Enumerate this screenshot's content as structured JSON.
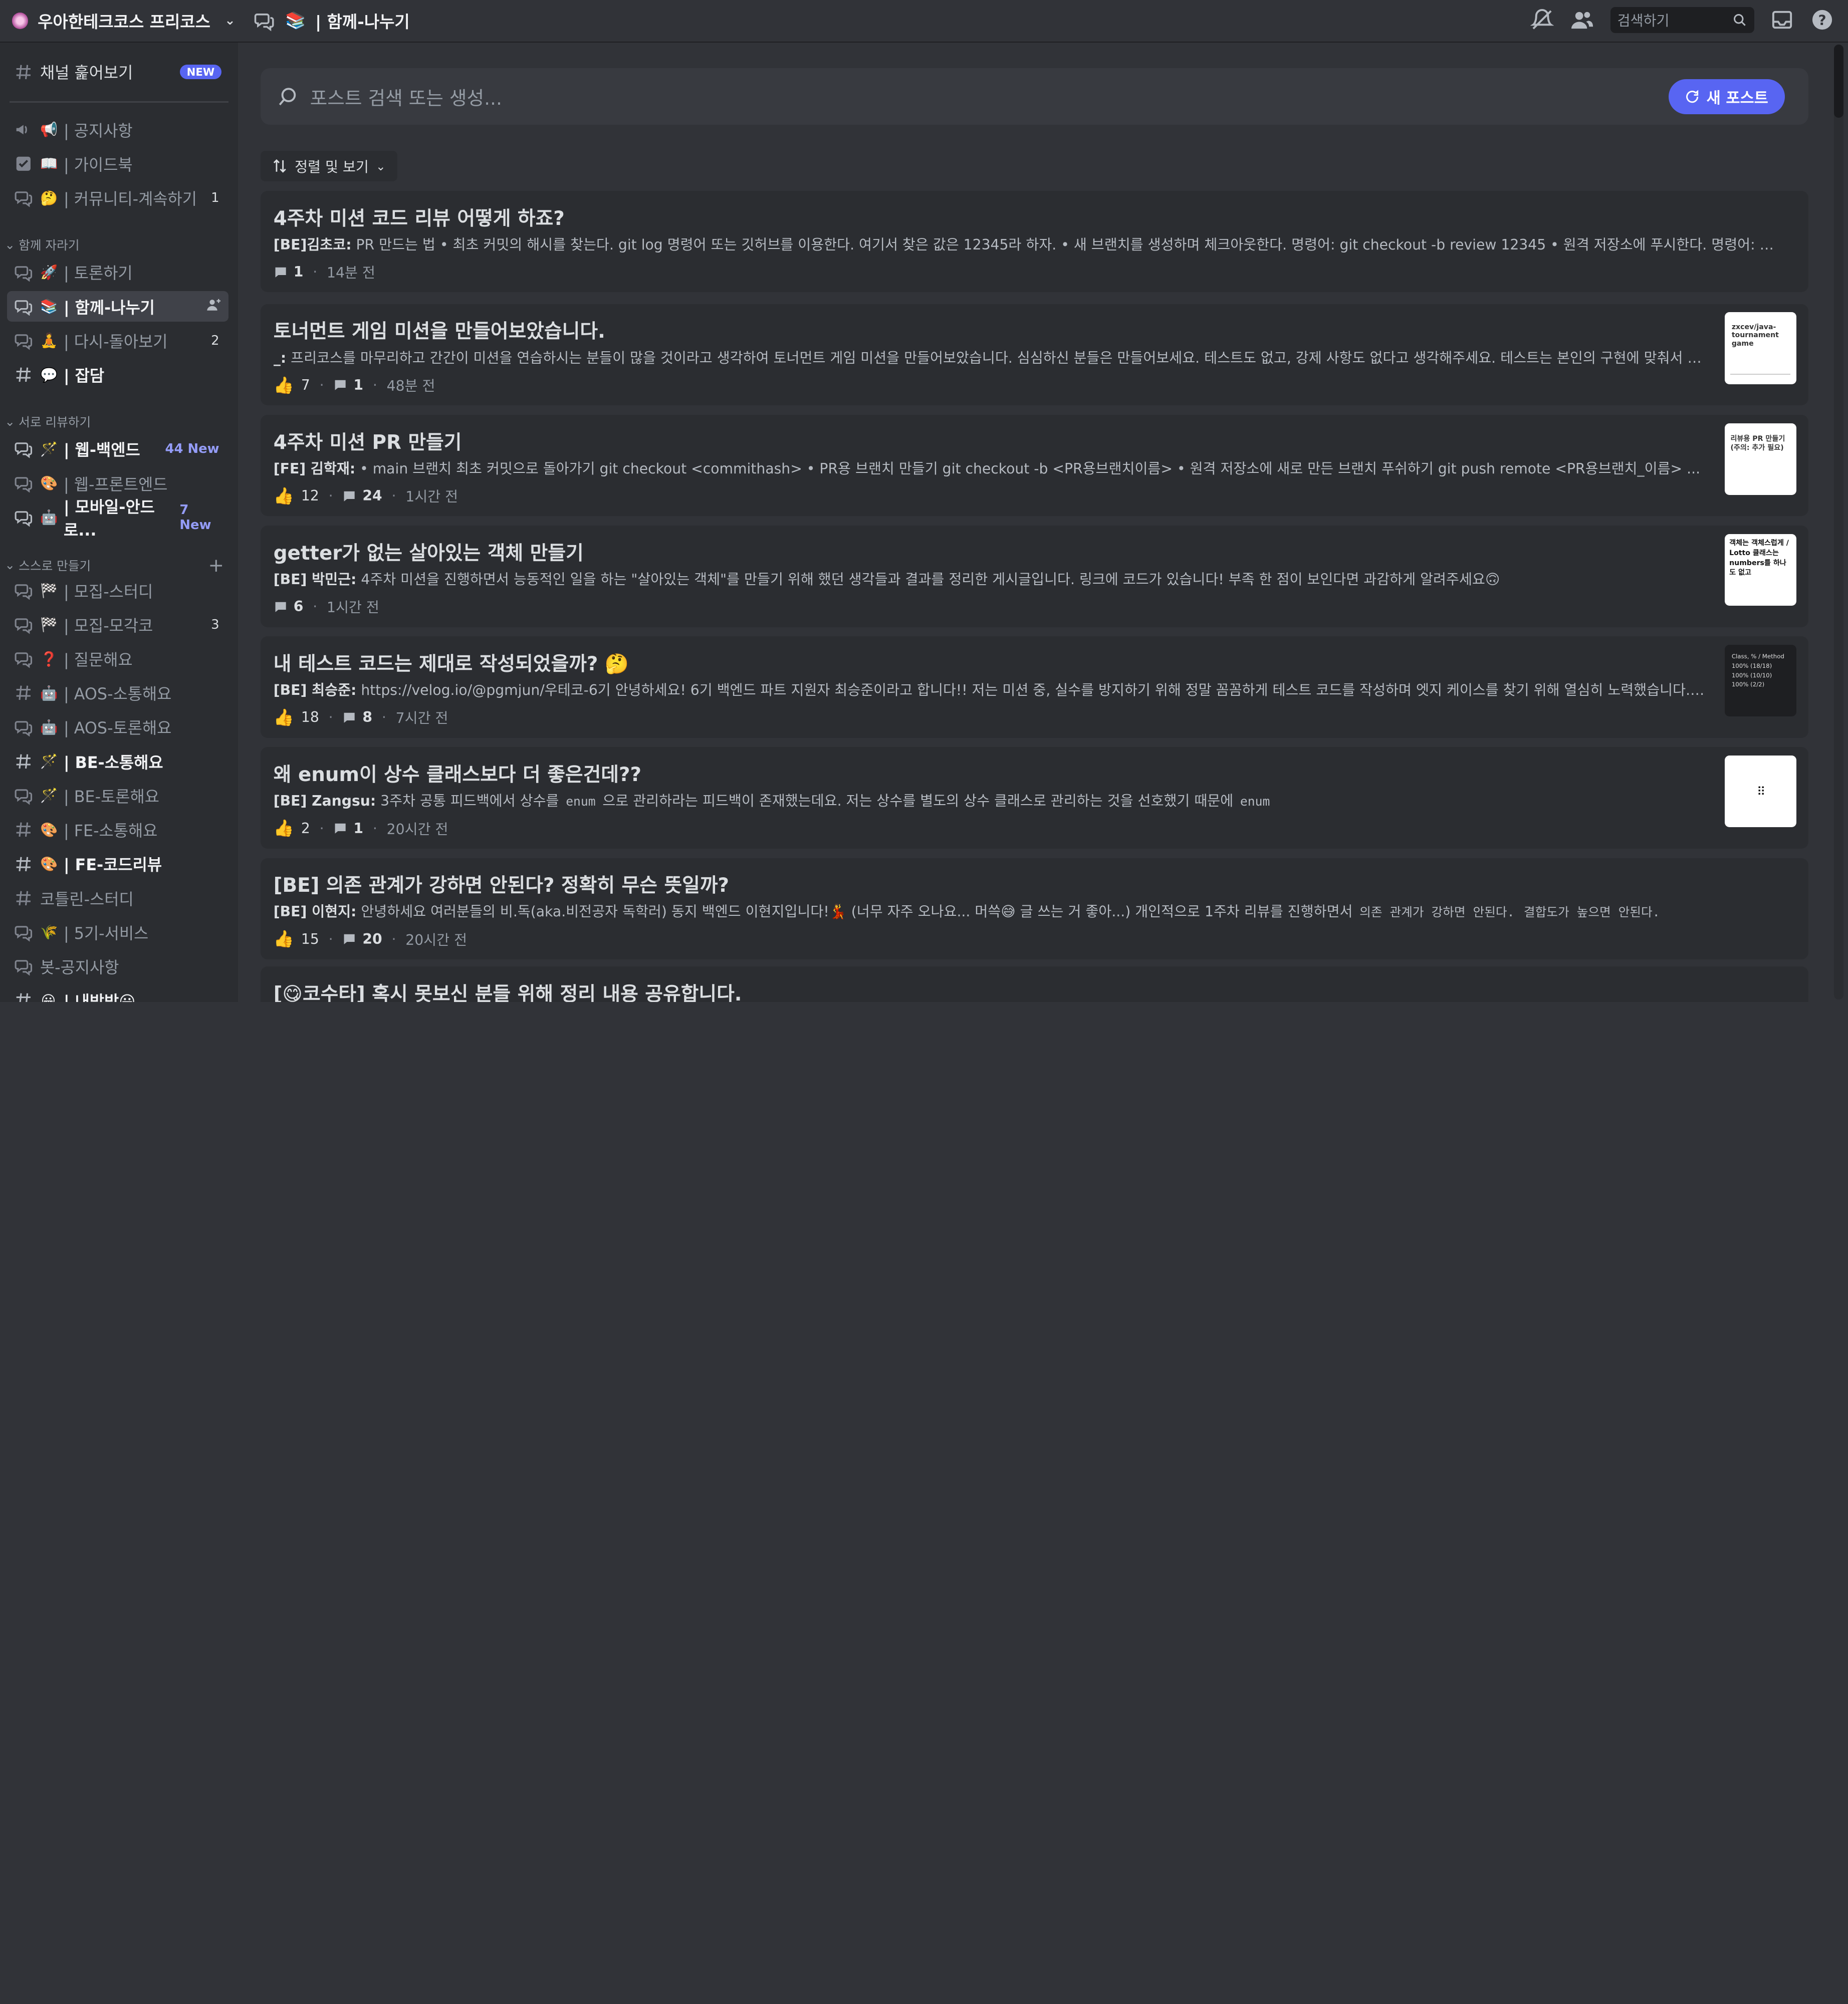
{
  "server": {
    "name": "우아한테크코스 프리코스"
  },
  "channel": {
    "emoji": "📚",
    "name": "| 함께-나누기"
  },
  "topbar": {
    "search_placeholder": "검색하기"
  },
  "sidebar": {
    "browse": {
      "label": "채널 훑어보기",
      "badge": "NEW"
    },
    "top_items": [
      {
        "emoji": "📢",
        "label": "| 공지사항"
      },
      {
        "emoji": "📖",
        "label": "| 가이드북"
      },
      {
        "emoji": "🤔",
        "label": "| 커뮤니티-계속하기",
        "count": "1"
      }
    ],
    "cat1": "함께 자라기",
    "cat1_items": [
      {
        "emoji": "🚀",
        "label": "| 토론하기"
      },
      {
        "emoji": "📚",
        "label": "| 함께-나누기"
      },
      {
        "emoji": "🧘",
        "label": "| 다시-돌아보기",
        "count": "2"
      },
      {
        "emoji": "💬",
        "label": "| 잡담"
      }
    ],
    "cat2": "서로 리뷰하기",
    "cat2_items": [
      {
        "emoji": "🪄",
        "label": "| 웹-백엔드",
        "count": "44 New"
      },
      {
        "emoji": "🎨",
        "label": "| 웹-프론트엔드"
      },
      {
        "emoji": "🤖",
        "label": "| 모바일-안드로...",
        "count": "7 New"
      }
    ],
    "cat3": "스스로 만들기",
    "cat3_items": [
      {
        "emoji": "🏁",
        "label": "| 모집-스터디"
      },
      {
        "emoji": "🏁",
        "label": "| 모집-모각코",
        "count": "3"
      },
      {
        "emoji": "❓",
        "label": "| 질문해요"
      },
      {
        "emoji": "🤖",
        "label": "| AOS-소통해요"
      },
      {
        "emoji": "🤖",
        "label": "| AOS-토론해요"
      },
      {
        "emoji": "🪄",
        "label": "| BE-소통해요"
      },
      {
        "emoji": "🪄",
        "label": "| BE-토론해요"
      },
      {
        "emoji": "🎨",
        "label": "| FE-소통해요"
      },
      {
        "emoji": "🎨",
        "label": "| FE-코드리뷰"
      },
      {
        "emoji": "",
        "label": "코틀린-스터디"
      },
      {
        "emoji": "🌾",
        "label": "| 5기-서비스"
      },
      {
        "emoji": "",
        "label": "봇-공지사항"
      },
      {
        "emoji": "😀",
        "label": "| 내방방😀"
      }
    ]
  },
  "main": {
    "search_placeholder": "포스트 검색 또는 생성...",
    "new_post": "새 포스트",
    "sort": "정렬 및 보기",
    "posts": [
      {
        "title": "4주차 미션 코드 리뷰 어떻게 하죠?",
        "author": "[BE]김초코:",
        "excerpt": " PR 만드는 법    • 최초 커밋의 해시를 찾는다.     git log 명령어 또는 깃허브를 이용한다. 여기서 찾은 값은 12345라 하자. • 새 브랜치를 생성하며 체크아웃한다.     명령어: git checkout -b review 12345 • 원격 저장소에 푸시한다.     명령어: git push origin review ...",
        "likes": "",
        "comments": "1",
        "time": "14분 전"
      },
      {
        "title": "토너먼트 게임 미션을 만들어보았습니다.",
        "author": "_:",
        "excerpt": " 프리코스를 마무리하고 간간이 미션을 연습하시는 분들이 많을 것이라고 생각하여 토너먼트 게임 미션을 만들어보았습니다. 심심하신 분들은 만들어보세요. 테스트도 없고, 강제 사항도 없다고 생각해주세요. 테스트는 본인의 구현에 맞춰서 직접 만들어주세요. 요구...",
        "likes": "7",
        "comments": "1",
        "time": "48분 전",
        "thumb_text": "zxcev/java-tournament game"
      },
      {
        "title": "4주차 미션 PR 만들기",
        "author": "[FE] 김학재:",
        "excerpt": " • main 브랜치 최초 커밋으로 돌아가기     git checkout <commithash> • PR용 브랜치 만들기     git checkout -b <PR용브랜치이름> • 원격 저장소에 새로 만든 브랜치 푸쉬하기     git push remote <PR용브랜치_이름> ...",
        "likes": "12",
        "comments": "24",
        "time": "1시간 전",
        "thumb_text": "리뷰용 PR 만들기 (주의: 추가 필요)"
      },
      {
        "title": "getter가 없는 살아있는 객체 만들기",
        "author": "[BE] 박민근:",
        "excerpt": " 4주차 미션을 진행하면서 능동적인 일을 하는 \"살아있는 객체\"를 만들기 위해 했던 생각들과 결과를 정리한 게시글입니다. 링크에 코드가 있습니다! 부족 한 점이 보인다면 과감하게 알려주세요🙃",
        "likes": "",
        "comments": "6",
        "time": "1시간 전",
        "thumb_text": "객체는 객체스럽게 / Lotto 클래스는 numbers를 하나도 없고"
      },
      {
        "title": "내 테스트 코드는 제대로 작성되었을까? 🤔",
        "author": "[BE] 최승준:",
        "excerpt": " https://velog.io/@pgmjun/우테코-6기 안녕하세요! 6기 백엔드 파트 지원자 최승준이라고 합니다!! 저는 미션 중, 실수를 방지하기 위해 정말 꼼꼼하게 테스트 코드를 작성하며 엣지 케이스를 찾기 위해 열심히 노력했습니다. 하지만 미션 코드가 길어지...",
        "likes": "18",
        "comments": "8",
        "time": "7시간 전",
        "thumb_text": "Class, % / Method 100% (18/18) 100% (10/10) 100% (2/2)"
      },
      {
        "title": "왜 enum이 상수 클래스보다 더 좋은건데??",
        "author": "[BE] Zangsu:",
        "excerpt": " 3주차 공통 피드백에서 상수를 ",
        "code1": "enum",
        "excerpt2": " 으로 관리하라는 피드백이 존재했는데요. 저는 상수를 별도의 상수 클래스로 관리하는 것을 선호했기 때문에 ",
        "code2": "enum",
        "likes": "2",
        "comments": "1",
        "time": "20시간 전"
      },
      {
        "title": "[BE] 의존 관계가 강하면 안된다? 정확히 무슨 뜻일까?",
        "author": "[BE] 이현지:",
        "excerpt": " 안녕하세요 여러분들의 비.독(aka.비전공자 독학러) 동지 백엔드 이현지입니다!💃 (너무 자주 오나요... 머쓱😅 글 쓰는 거 좋아...) 개인적으로 1주차 리뷰를 진행하면서 ",
        "code1": "의존 관계가 강하면 안된다.",
        "excerpt2": " ",
        "code2": "결합도가 높으면 안된다.",
        "likes": "15",
        "comments": "20",
        "time": "20시간 전"
      },
      {
        "title": "[😋코수타] 혹시 못보신 분들 위해 정리 내용 공유합니다."
      }
    ]
  }
}
